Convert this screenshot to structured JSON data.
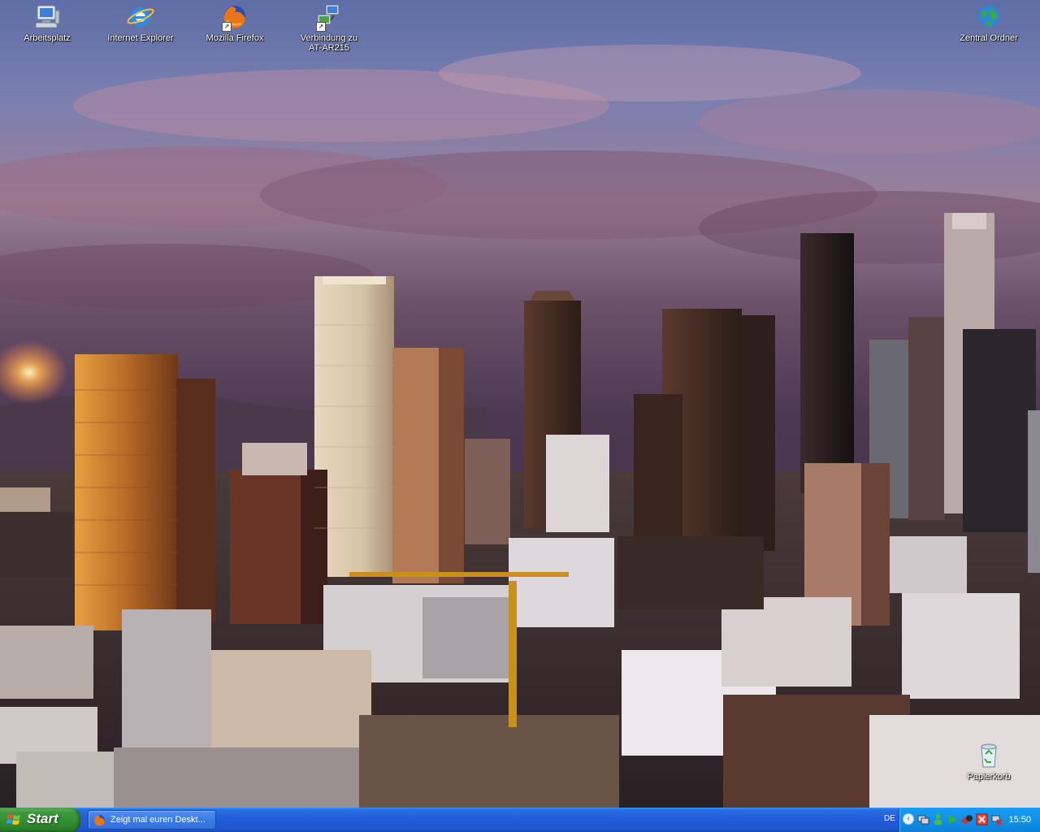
{
  "desktop": {
    "icons": [
      {
        "label": "Arbeitsplatz"
      },
      {
        "label": "Internet Explorer"
      },
      {
        "label": "Mozilla Firefox"
      },
      {
        "label": "Verbindung zu\nAT-AR215"
      },
      {
        "label": "Zentral Ordner"
      },
      {
        "label": "Papierkorb"
      }
    ]
  },
  "taskbar": {
    "start_label": "Start",
    "window_title": "Zeigt mal euren Deskt...",
    "language": "DE",
    "clock": "15:50"
  },
  "colors": {
    "taskbar_blue": "#245edb",
    "start_green": "#3c9a3c",
    "tray_blue": "#1291e8"
  }
}
